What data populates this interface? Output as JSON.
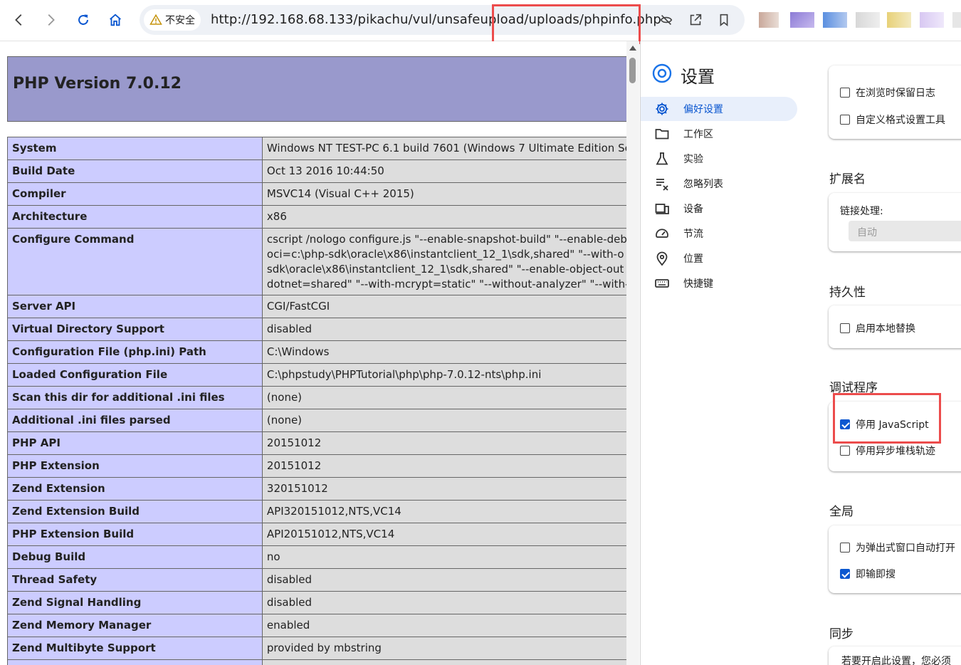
{
  "browser": {
    "security_chip": "不安全",
    "url": "http://192.168.68.133/pikachu/vul/unsafeupload/uploads/phpinfo.php"
  },
  "colors": {
    "php_header": "#9999cc",
    "php_label_cell": "#ccccff",
    "php_value_cell": "#dddddd",
    "highlight_box": "#ec4c4c",
    "accent": "#0b57d0"
  },
  "phpinfo": {
    "title": "PHP Version 7.0.12",
    "rows": [
      {
        "key": "System",
        "value": [
          "Windows NT TEST-PC 6.1 build 7601 (Windows 7 Ultimate Edition Ser"
        ]
      },
      {
        "key": "Build Date",
        "value": [
          "Oct 13 2016 10:44:50"
        ]
      },
      {
        "key": "Compiler",
        "value": [
          "MSVC14 (Visual C++ 2015)"
        ]
      },
      {
        "key": "Architecture",
        "value": [
          "x86"
        ]
      },
      {
        "key": "Configure Command",
        "value": [
          "cscript /nologo configure.js \"--enable-snapshot-build\" \"--enable-deb",
          "oci=c:\\php-sdk\\oracle\\x86\\instantclient_12_1\\sdk,shared\" \"--with-o",
          "sdk\\oracle\\x86\\instantclient_12_1\\sdk,shared\" \"--enable-object-out",
          "dotnet=shared\" \"--with-mcrypt=static\" \"--without-analyzer\" \"--with-"
        ]
      },
      {
        "key": "Server API",
        "value": [
          "CGI/FastCGI"
        ]
      },
      {
        "key": "Virtual Directory Support",
        "value": [
          "disabled"
        ]
      },
      {
        "key": "Configuration File (php.ini) Path",
        "value": [
          "C:\\Windows"
        ]
      },
      {
        "key": "Loaded Configuration File",
        "value": [
          "C:\\phpstudy\\PHPTutorial\\php\\php-7.0.12-nts\\php.ini"
        ]
      },
      {
        "key": "Scan this dir for additional .ini files",
        "value": [
          "(none)"
        ]
      },
      {
        "key": "Additional .ini files parsed",
        "value": [
          "(none)"
        ]
      },
      {
        "key": "PHP API",
        "value": [
          "20151012"
        ]
      },
      {
        "key": "PHP Extension",
        "value": [
          "20151012"
        ]
      },
      {
        "key": "Zend Extension",
        "value": [
          "320151012"
        ]
      },
      {
        "key": "Zend Extension Build",
        "value": [
          "API320151012,NTS,VC14"
        ]
      },
      {
        "key": "PHP Extension Build",
        "value": [
          "API20151012,NTS,VC14"
        ]
      },
      {
        "key": "Debug Build",
        "value": [
          "no"
        ]
      },
      {
        "key": "Thread Safety",
        "value": [
          "disabled"
        ]
      },
      {
        "key": "Zend Signal Handling",
        "value": [
          "disabled"
        ]
      },
      {
        "key": "Zend Memory Manager",
        "value": [
          "enabled"
        ]
      },
      {
        "key": "Zend Multibyte Support",
        "value": [
          "provided by mbstring"
        ]
      },
      {
        "key": "",
        "value": [
          ""
        ]
      }
    ]
  },
  "settings": {
    "title": "设置",
    "sidebar": [
      {
        "label": "偏好设置",
        "icon": "gear-icon",
        "active": true
      },
      {
        "label": "工作区",
        "icon": "folder-icon",
        "active": false
      },
      {
        "label": "实验",
        "icon": "flask-icon",
        "active": false
      },
      {
        "label": "忽略列表",
        "icon": "ignore-list-icon",
        "active": false
      },
      {
        "label": "设备",
        "icon": "devices-icon",
        "active": false
      },
      {
        "label": "节流",
        "icon": "speedometer-icon",
        "active": false
      },
      {
        "label": "位置",
        "icon": "location-pin-icon",
        "active": false
      },
      {
        "label": "快捷键",
        "icon": "keyboard-icon",
        "active": false
      }
    ],
    "top_card": {
      "options": [
        {
          "label": "在浏览时保留日志",
          "checked": false
        },
        {
          "label": "自定义格式设置工具",
          "checked": false
        }
      ]
    },
    "extensions": {
      "title": "扩展名",
      "link_handling_label": "链接处理:",
      "link_handling_value": "自动"
    },
    "persistence": {
      "title": "持久性",
      "options": [
        {
          "label": "启用本地替换",
          "checked": false
        }
      ]
    },
    "debugger": {
      "title": "调试程序",
      "options": [
        {
          "label": "停用 JavaScript",
          "checked": true
        },
        {
          "label": "停用异步堆栈轨迹",
          "checked": false
        }
      ]
    },
    "global": {
      "title": "全局",
      "options": [
        {
          "label": "为弹出式窗口自动打开",
          "checked": false
        },
        {
          "label": "即输即搜",
          "checked": true
        }
      ]
    },
    "sync": {
      "title": "同步",
      "text": "若要开启此设置，您必须"
    }
  }
}
